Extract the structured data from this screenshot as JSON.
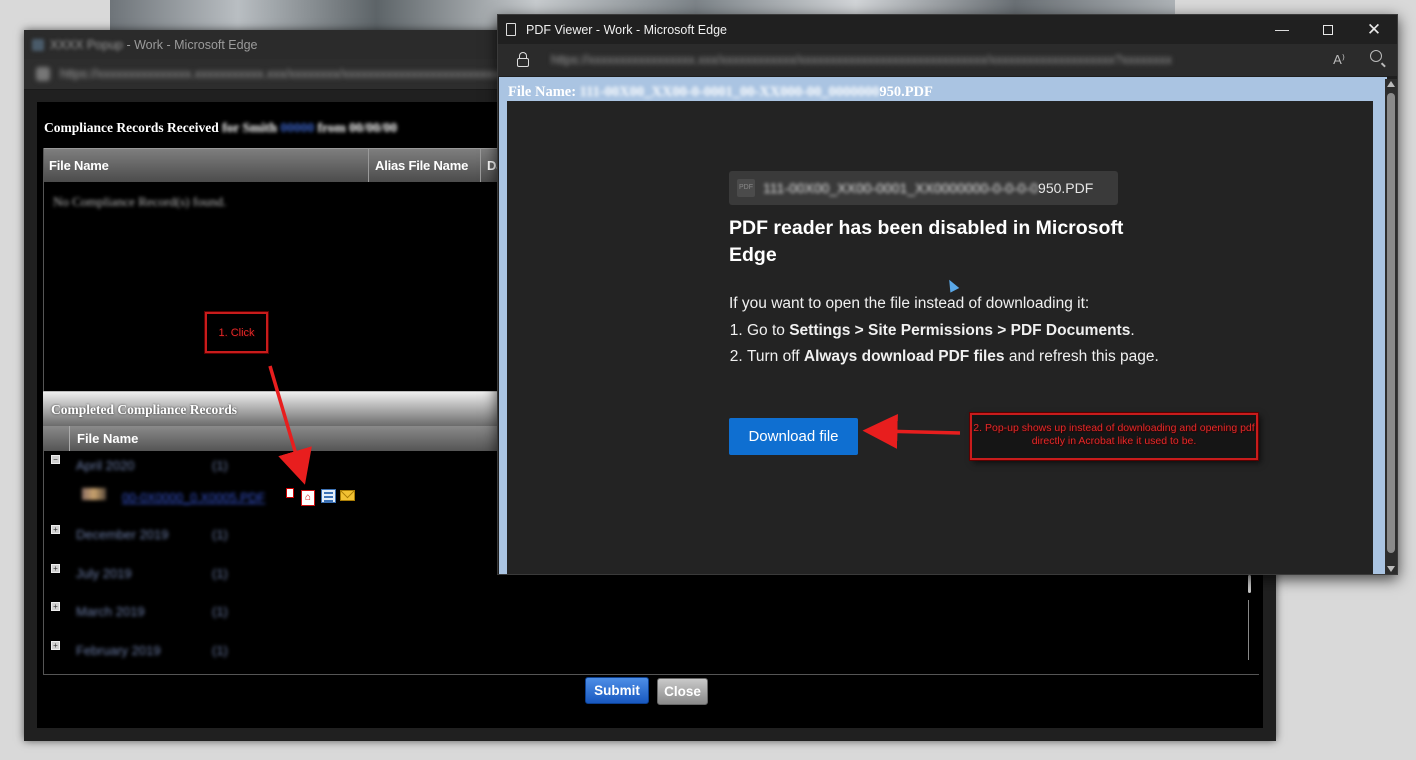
{
  "back_window": {
    "title_blurred": "XXXX Popup",
    "title_suffix": "- Work - Microsoft Edge",
    "url_blurred": "https://xxxxxxxxxxxxxxx.xxxxxxxxxxx.xxx/xxxxxxxx/xxxxxxxxxxxxxxxxxxxxxxxxx/xxxxxxxxxx",
    "records_title": "Compliance Records Received",
    "records_title_blur_1": "for Smith",
    "records_title_blur_blue": "00000",
    "records_title_blur_2": "from 00/00/00",
    "columns": [
      "File Name",
      "Alias File Name",
      "Da"
    ],
    "no_records_text": "No Compliance Record(s) found.",
    "completed_title": "Completed Compliance Records",
    "completed_column": "File Name",
    "rows": [
      {
        "month": "April 2020",
        "count": "(1)"
      },
      {
        "month": "December 2019",
        "count": "(1)"
      },
      {
        "month": "July 2019",
        "count": "(1)"
      },
      {
        "month": "March 2019",
        "count": "(1)"
      },
      {
        "month": "February 2019",
        "count": "(1)"
      }
    ],
    "file_link_text": "00-0X0000_0.X0005.PDF",
    "submit_label": "Submit",
    "close_label": "Close"
  },
  "front_window": {
    "title": "PDF Viewer - Work - Microsoft Edge",
    "url_blurred": "https://xxxxxxxxxxxxxxxxx.xxx/xxxxxxxxxxxx/xxxxxxxxxxxxxxxxxxxxxxxxxxxxxx/xxxxxxxxxxxxxxxxxxxx?xxxxxxxx",
    "file_name_label": "File Name:",
    "file_name_blurred": "111-00X00_XX00-0-0001_00-XX000-00_0000000",
    "file_name_visible": "950.PDF",
    "chip_icon_text": "PDF",
    "chip_name_blurred": "111-00X00_XX00-0001_XX0000000-0-0-0-0",
    "chip_name_visible": "950.PDF",
    "heading": "PDF reader has been disabled in Microsoft Edge",
    "intro": "If you want to open the file instead of downloading it:",
    "step1_prefix": "Go to ",
    "step1_bold": "Settings > Site Permissions > PDF Documents",
    "step1_suffix": ".",
    "step2_prefix": "Turn off ",
    "step2_bold": "Always download PDF files",
    "step2_suffix": " and refresh this page.",
    "download_label": "Download file"
  },
  "annotations": {
    "note1": "1. Click",
    "note2": "2. Pop-up shows up instead of downloading and opening pdf directly in Acrobat like it used to be."
  },
  "colors": {
    "accent_blue": "#0f6fd1",
    "annotation_red": "#e42828"
  }
}
